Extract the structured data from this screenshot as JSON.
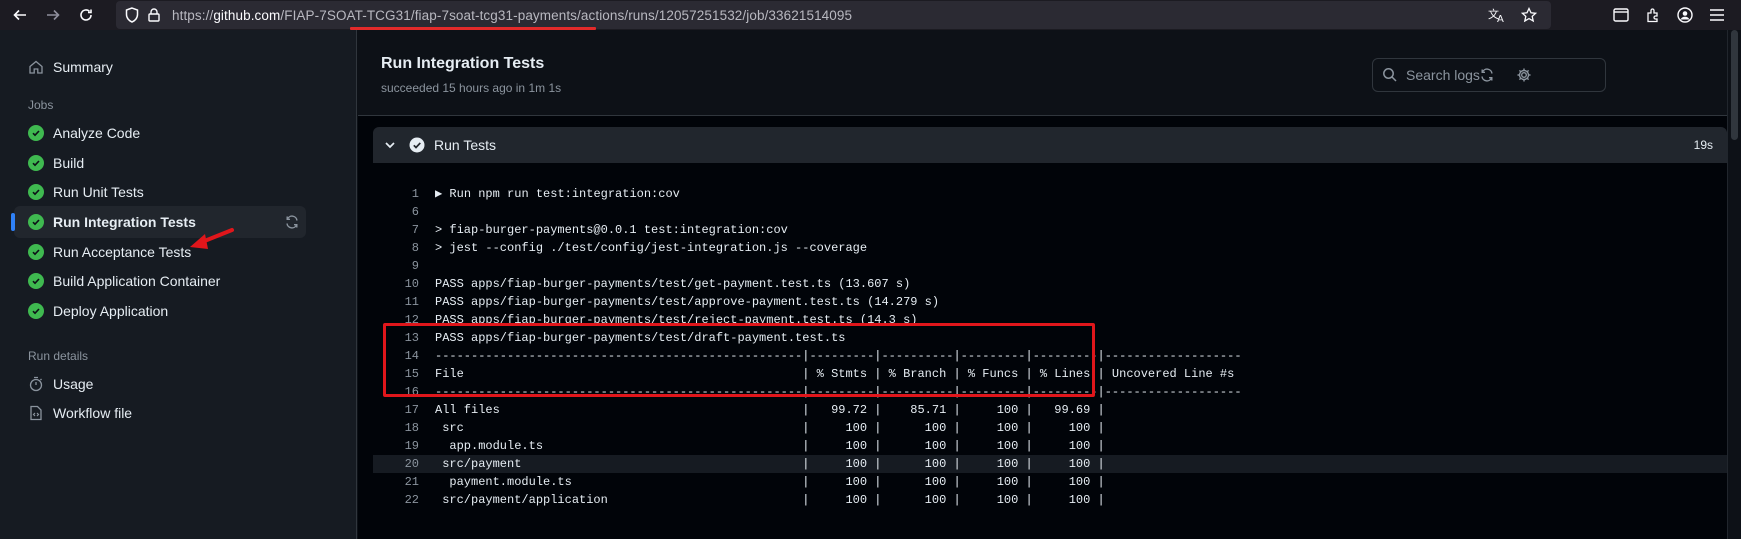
{
  "browser": {
    "url_prefix": "https://",
    "url_host": "github.com",
    "url_path": "/FIAP-7SOAT-TCG31/fiap-7soat-tcg31-payments/actions/runs/12057251532/job/33621514095"
  },
  "sidebar": {
    "summary_label": "Summary",
    "jobs_heading": "Jobs",
    "jobs": [
      {
        "label": "Analyze Code"
      },
      {
        "label": "Build"
      },
      {
        "label": "Run Unit Tests"
      },
      {
        "label": "Run Integration Tests"
      },
      {
        "label": "Run Acceptance Tests"
      },
      {
        "label": "Build Application Container"
      },
      {
        "label": "Deploy Application"
      }
    ],
    "run_details_heading": "Run details",
    "usage_label": "Usage",
    "workflow_file_label": "Workflow file"
  },
  "job": {
    "title": "Run Integration Tests",
    "subtitle": "succeeded 15 hours ago in 1m 1s",
    "search_placeholder": "Search logs"
  },
  "step": {
    "title": "Run Tests",
    "duration": "19s"
  },
  "log_lines": [
    {
      "num": "1",
      "text": "▶ Run npm run test:integration:cov"
    },
    {
      "num": "6",
      "text": ""
    },
    {
      "num": "7",
      "text": "> fiap-burger-payments@0.0.1 test:integration:cov"
    },
    {
      "num": "8",
      "text": "> jest --config ./test/config/jest-integration.js --coverage"
    },
    {
      "num": "9",
      "text": ""
    },
    {
      "num": "10",
      "text": "PASS apps/fiap-burger-payments/test/get-payment.test.ts (13.607 s)"
    },
    {
      "num": "11",
      "text": "PASS apps/fiap-burger-payments/test/approve-payment.test.ts (14.279 s)"
    },
    {
      "num": "12",
      "text": "PASS apps/fiap-burger-payments/test/reject-payment.test.ts (14.3 s)"
    },
    {
      "num": "13",
      "text": "PASS apps/fiap-burger-payments/test/draft-payment.test.ts"
    },
    {
      "num": "14",
      "text": "---------------------------------------------------|---------|----------|---------|---------|-------------------"
    },
    {
      "num": "15",
      "text": "File                                               | % Stmts | % Branch | % Funcs | % Lines | Uncovered Line #s"
    },
    {
      "num": "16",
      "text": "---------------------------------------------------|---------|----------|---------|---------|-------------------"
    },
    {
      "num": "17",
      "text": "All files                                          |   99.72 |    85.71 |     100 |   99.69 |"
    },
    {
      "num": "18",
      "text": " src                                               |     100 |      100 |     100 |     100 |"
    },
    {
      "num": "19",
      "text": "  app.module.ts                                    |     100 |      100 |     100 |     100 |"
    },
    {
      "num": "20",
      "text": " src/payment                                       |     100 |      100 |     100 |     100 |"
    },
    {
      "num": "21",
      "text": "  payment.module.ts                                |     100 |      100 |     100 |     100 |"
    },
    {
      "num": "22",
      "text": " src/payment/application                           |     100 |      100 |     100 |     100 |"
    }
  ]
}
